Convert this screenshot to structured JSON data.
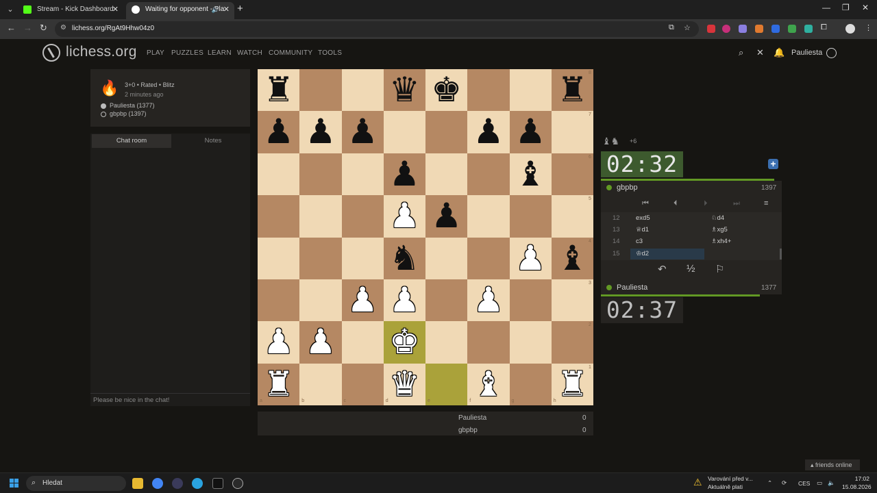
{
  "browser": {
    "tabs": [
      {
        "label": "Stream - Kick Dashboard",
        "favicon_color": "#53fc18"
      },
      {
        "label": "Waiting for opponent - Pla",
        "favicon_color": "#ffffff"
      }
    ],
    "url": "lichess.org/RgAt9Hhw04z0"
  },
  "site": {
    "name": "lichess.org",
    "nav": [
      "PLAY",
      "PUZZLES",
      "LEARN",
      "WATCH",
      "COMMUNITY",
      "TOOLS"
    ],
    "username": "Pauliesta"
  },
  "game_info": {
    "mode": "3+0 • Rated • Blitz",
    "time_ago": "2 minutes ago",
    "white": "Pauliesta (1377)",
    "black": "gbpbp (1397)"
  },
  "chat": {
    "tabs": [
      "Chat room",
      "Notes"
    ],
    "placeholder": "Please be nice in the chat!"
  },
  "board": {
    "files": [
      "a",
      "b",
      "c",
      "d",
      "e",
      "f",
      "g",
      "h"
    ],
    "ranks": [
      "8",
      "7",
      "6",
      "5",
      "4",
      "3",
      "2",
      "1"
    ],
    "pieces": [
      {
        "sq": "a8",
        "p": "♜"
      },
      {
        "sq": "d8",
        "p": "♛"
      },
      {
        "sq": "e8",
        "p": "♚"
      },
      {
        "sq": "h8",
        "p": "♜"
      },
      {
        "sq": "a7",
        "p": "♟"
      },
      {
        "sq": "b7",
        "p": "♟"
      },
      {
        "sq": "c7",
        "p": "♟"
      },
      {
        "sq": "f7",
        "p": "♟"
      },
      {
        "sq": "g7",
        "p": "♟"
      },
      {
        "sq": "d6",
        "p": "♟"
      },
      {
        "sq": "g6",
        "p": "♝"
      },
      {
        "sq": "d5",
        "p": "♙"
      },
      {
        "sq": "e5",
        "p": "♟"
      },
      {
        "sq": "d4",
        "p": "♞"
      },
      {
        "sq": "g4",
        "p": "♙"
      },
      {
        "sq": "h4",
        "p": "♝"
      },
      {
        "sq": "c3",
        "p": "♙"
      },
      {
        "sq": "d3",
        "p": "♙"
      },
      {
        "sq": "f3",
        "p": "♙"
      },
      {
        "sq": "a2",
        "p": "♙"
      },
      {
        "sq": "b2",
        "p": "♙"
      },
      {
        "sq": "d2",
        "p": "♔"
      },
      {
        "sq": "a1",
        "p": "♖"
      },
      {
        "sq": "d1",
        "p": "♕"
      },
      {
        "sq": "f1",
        "p": "♗"
      },
      {
        "sq": "h1",
        "p": "♖"
      }
    ],
    "highlight": [
      "d2",
      "e1"
    ]
  },
  "material": {
    "icons": "♝♞",
    "diff": "+6"
  },
  "clocks": {
    "top": "02:32",
    "bottom": "02:37"
  },
  "players": {
    "top": {
      "name": "gbpbp",
      "rating": "1397"
    },
    "bottom": {
      "name": "Pauliesta",
      "rating": "1377"
    }
  },
  "moves": [
    {
      "n": "12",
      "w": "exd5",
      "b": "♘d4"
    },
    {
      "n": "13",
      "w": "♕d1",
      "b": "♗xg5"
    },
    {
      "n": "14",
      "w": "c3",
      "b": "♗xh4+"
    },
    {
      "n": "15",
      "w": "♔d2",
      "b": ""
    }
  ],
  "score": [
    {
      "name": "Pauliesta",
      "val": "0"
    },
    {
      "name": "gbpbp",
      "val": "0"
    }
  ],
  "friends": "friends online",
  "taskbar": {
    "search": "Hledat",
    "notice1": "Varování před v...",
    "notice2": "Aktuálně plati",
    "lang": "CES",
    "time": "17:02",
    "date": "15.08.2026"
  }
}
